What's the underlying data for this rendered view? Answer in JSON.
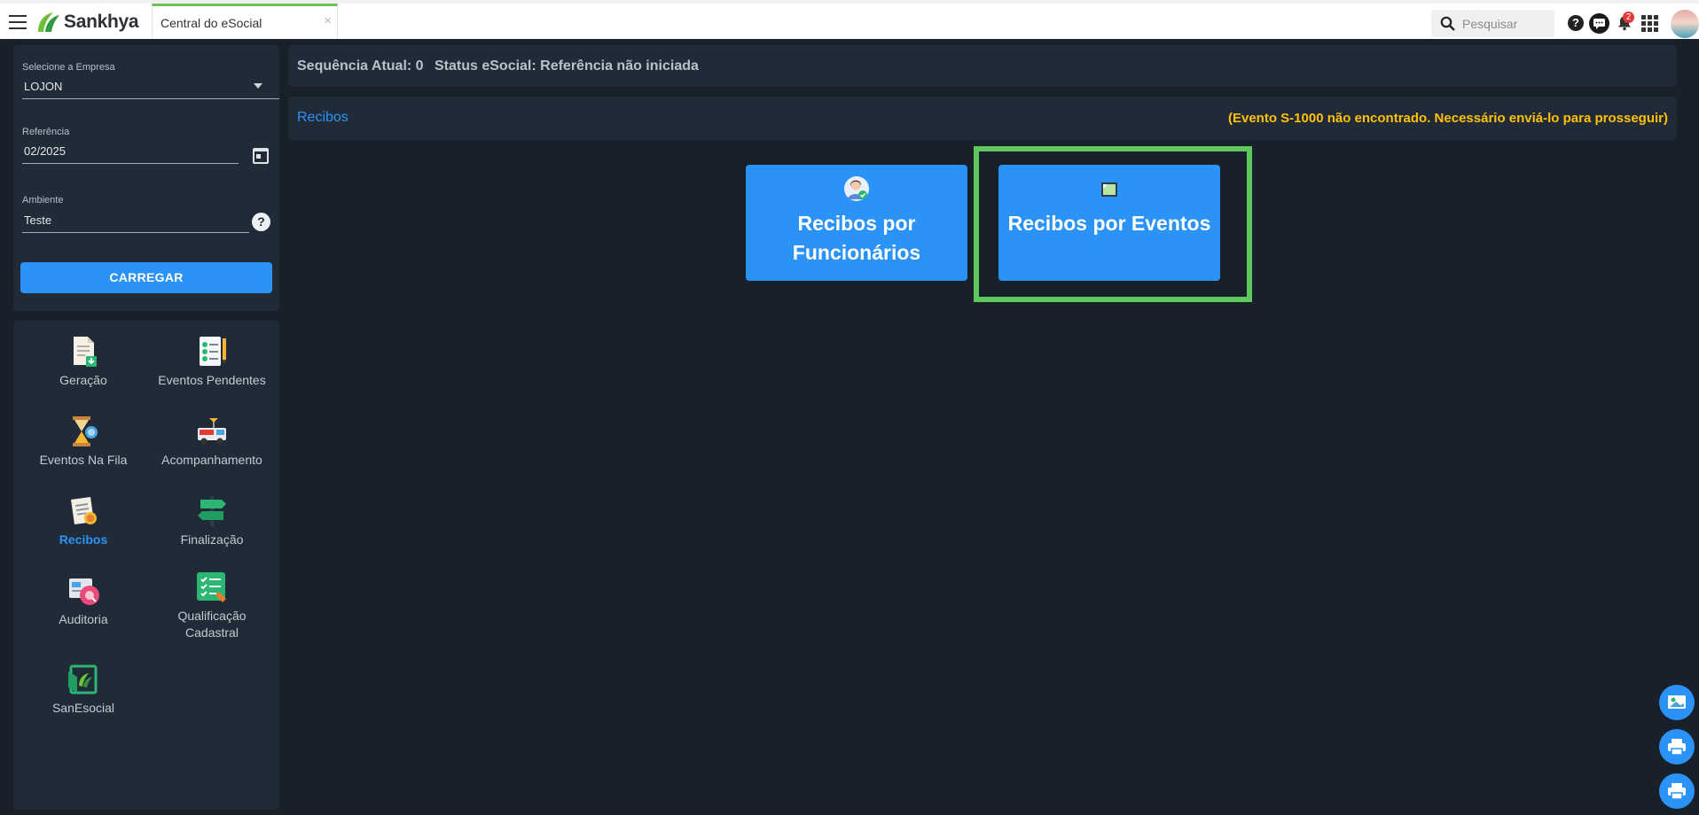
{
  "app": {
    "brand": "Sankhya",
    "tab_label": "Central do eSocial",
    "tab_close": "×",
    "search_placeholder": "Pesquisar",
    "notification_count": "2",
    "help_glyph": "?"
  },
  "form": {
    "company_label": "Selecione a Empresa",
    "company_value": "LOJON",
    "reference_label": "Referência",
    "reference_value": "02/2025",
    "environment_label": "Ambiente",
    "environment_value": "Teste",
    "load_button": "CARREGAR"
  },
  "menu": {
    "items": [
      {
        "label": "Geração",
        "icon": "document-download-icon"
      },
      {
        "label": "Eventos Pendentes",
        "icon": "checklist-icon"
      },
      {
        "label": "Eventos Na Fila",
        "icon": "hourglass-icon"
      },
      {
        "label": "Acompanhamento",
        "icon": "news-van-icon"
      },
      {
        "label": "Recibos",
        "icon": "receipt-icon",
        "active": true
      },
      {
        "label": "Finalização",
        "icon": "signpost-icon"
      },
      {
        "label": "Auditoria",
        "icon": "audit-icon"
      },
      {
        "label": "Qualificação Cadastral",
        "icon": "qualification-icon"
      },
      {
        "label": "SanEsocial",
        "icon": "sanesocial-icon"
      }
    ]
  },
  "status": {
    "sequence": "Sequência Atual: 0",
    "esocial_status": "Status eSocial: Referência não iniciada"
  },
  "section": {
    "title": "Recibos",
    "warning": "(Evento S-1000 não encontrado. Necessário enviá-lo para prosseguir)"
  },
  "cards": {
    "employees_line1": "Recibos por",
    "employees_line2": "Funcionários",
    "events": "Recibos por Eventos"
  },
  "colors": {
    "accent": "#2a93f5",
    "warning": "#ffc107",
    "highlight": "#5cc95a",
    "background": "#18212b",
    "panel": "#202b37"
  }
}
